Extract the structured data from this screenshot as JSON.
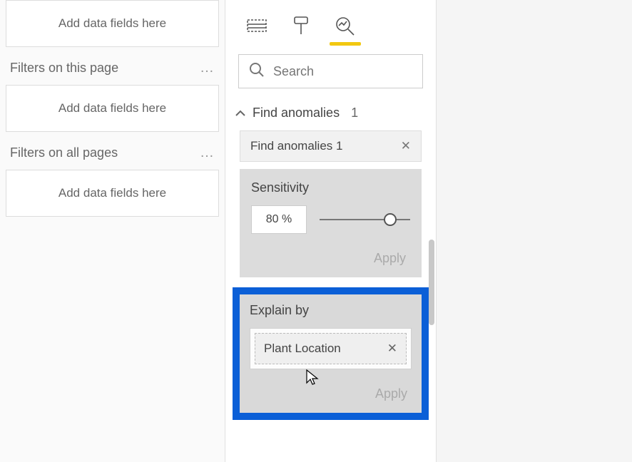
{
  "filters_pane": {
    "add_placeholder": "Add data fields here",
    "page_filters_label": "Filters on this page",
    "all_pages_label": "Filters on all pages"
  },
  "search": {
    "placeholder": "Search"
  },
  "anomalies": {
    "section_label": "Find anomalies",
    "count": "1",
    "chip_label": "Find anomalies 1",
    "sensitivity_label": "Sensitivity",
    "sensitivity_value": "80  %",
    "apply_label": "Apply"
  },
  "explain": {
    "label": "Explain by",
    "field": "Plant Location",
    "apply_label": "Apply"
  }
}
